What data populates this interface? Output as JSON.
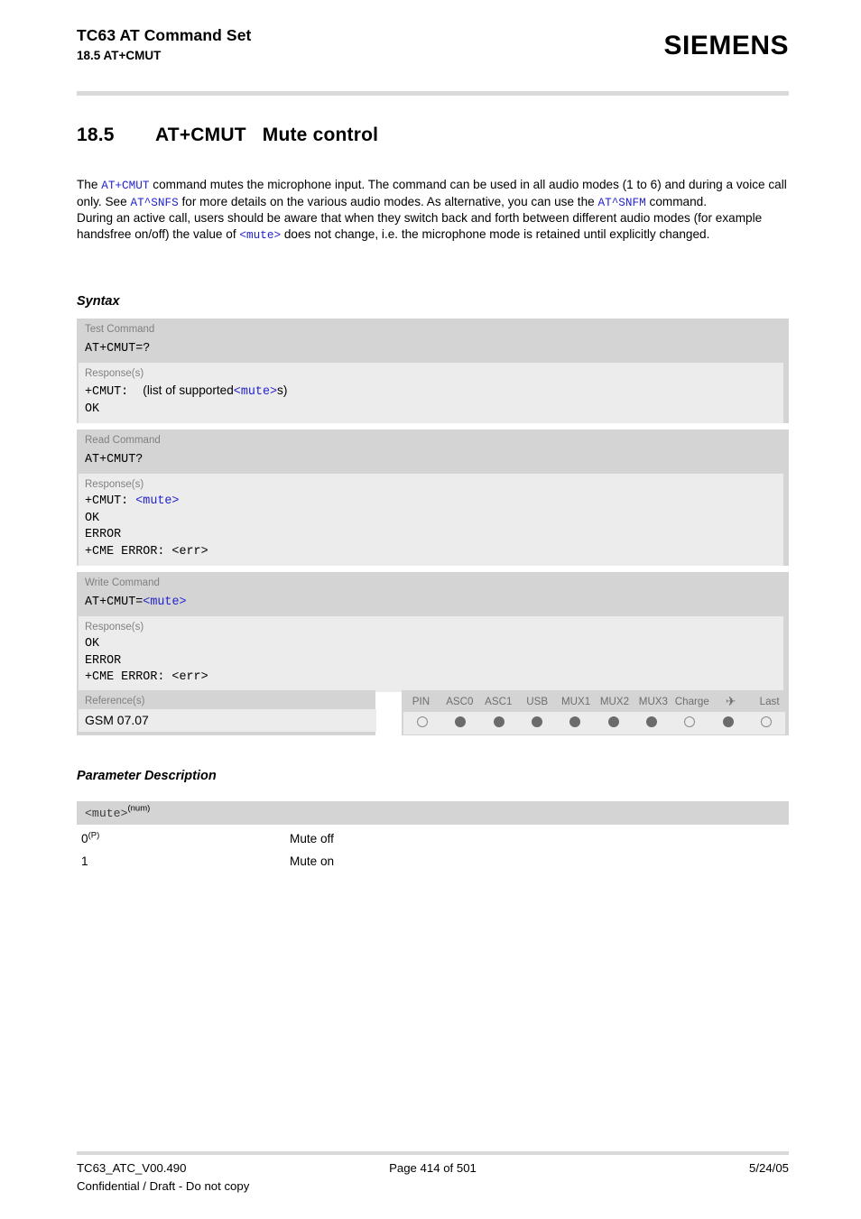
{
  "header": {
    "title": "TC63 AT Command Set",
    "subtitle": "18.5 AT+CMUT",
    "brand": "SIEMENS"
  },
  "section": {
    "number": "18.5",
    "command": "AT+CMUT",
    "name": "Mute control"
  },
  "intro": {
    "p1_a": "The ",
    "p1_code1": "AT+CMUT",
    "p1_b": " command mutes the microphone input. The command can be used in all audio modes (1 to 6) and during a voice call only. See ",
    "p1_code2": "AT^SNFS",
    "p1_c": " for more details on the various audio modes. As alternative, you can use the ",
    "p1_code3": "AT^SNFM",
    "p1_d": " command.",
    "p2_a": "During an active call, users should be aware that when they switch back and forth between different audio modes (for example handsfree on/off) the value of ",
    "p2_code1": "<mute>",
    "p2_b": " does not change, i.e. the microphone mode is retained until explicitly changed."
  },
  "headings": {
    "syntax": "Syntax",
    "parameter_description": "Parameter Description"
  },
  "syntax": {
    "test": {
      "label": "Test Command",
      "command": "AT+CMUT=?",
      "response_label": "Response(s)",
      "resp_prefix": "+CMUT:  ",
      "resp_text": "(list of supported",
      "resp_param": "<mute>",
      "resp_suffix": "s)",
      "resp_ok": "OK"
    },
    "read": {
      "label": "Read Command",
      "command": "AT+CMUT?",
      "response_label": "Response(s)",
      "resp_prefix": "+CMUT: ",
      "resp_param": "<mute>",
      "lines": [
        "OK",
        "ERROR",
        "+CME ERROR: <err>"
      ]
    },
    "write": {
      "label": "Write Command",
      "command_prefix": "AT+CMUT=",
      "command_param": "<mute>",
      "response_label": "Response(s)",
      "lines": [
        "OK",
        "ERROR",
        "+CME ERROR: <err>"
      ]
    }
  },
  "reference": {
    "label": "Reference(s)",
    "value": "GSM 07.07"
  },
  "indicators": {
    "columns": [
      {
        "label": "PIN",
        "state": "off",
        "icon": ""
      },
      {
        "label": "ASC0",
        "state": "on",
        "icon": ""
      },
      {
        "label": "ASC1",
        "state": "on",
        "icon": ""
      },
      {
        "label": "USB",
        "state": "on",
        "icon": ""
      },
      {
        "label": "MUX1",
        "state": "on",
        "icon": ""
      },
      {
        "label": "MUX2",
        "state": "on",
        "icon": ""
      },
      {
        "label": "MUX3",
        "state": "on",
        "icon": ""
      },
      {
        "label": "Charge",
        "state": "off",
        "icon": ""
      },
      {
        "label": "✈",
        "state": "on",
        "icon": "airplane-icon"
      },
      {
        "label": "Last",
        "state": "off",
        "icon": ""
      }
    ]
  },
  "parameters": {
    "name": "<mute>",
    "type": "(num)",
    "rows": [
      {
        "value": "0",
        "value_sup": "(P)",
        "description": "Mute off"
      },
      {
        "value": "1",
        "value_sup": "",
        "description": "Mute on"
      }
    ]
  },
  "footer": {
    "doc_id": "TC63_ATC_V00.490",
    "page": "Page 414 of 501",
    "date": "5/24/05",
    "confidential": "Confidential / Draft - Do not copy"
  },
  "colors": {
    "code_blue": "#2222cc",
    "band_dark": "#d4d4d4",
    "band_light": "#ececec",
    "label_gray": "#808080"
  }
}
